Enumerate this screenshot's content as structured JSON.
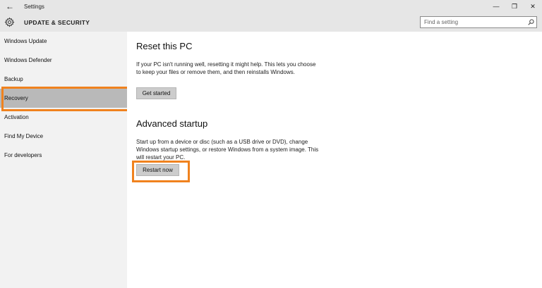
{
  "window": {
    "title": "Settings",
    "back_glyph": "←",
    "minimize_glyph": "—",
    "maximize_glyph": "❐",
    "close_glyph": "✕"
  },
  "header": {
    "section_title": "UPDATE & SECURITY",
    "search_placeholder": "Find a setting"
  },
  "sidebar": {
    "items": [
      {
        "label": "Windows Update"
      },
      {
        "label": "Windows Defender"
      },
      {
        "label": "Backup"
      },
      {
        "label": "Recovery",
        "active": true
      },
      {
        "label": "Activation"
      },
      {
        "label": "Find My Device"
      },
      {
        "label": "For developers"
      }
    ]
  },
  "main": {
    "reset": {
      "title": "Reset this PC",
      "description": "If your PC isn't running well, resetting it might help. This lets you choose to keep your files or remove them, and then reinstalls Windows.",
      "button": "Get started"
    },
    "advanced": {
      "title": "Advanced startup",
      "description": "Start up from a device or disc (such as a USB drive or DVD), change Windows startup settings, or restore Windows from a system image. This will restart your PC.",
      "button": "Restart now"
    }
  },
  "colors": {
    "highlight": "#f0821e",
    "sidebar_bg": "#f2f2f2",
    "active_item_bg": "#b9b9b9",
    "header_bg": "#e6e6e6"
  }
}
